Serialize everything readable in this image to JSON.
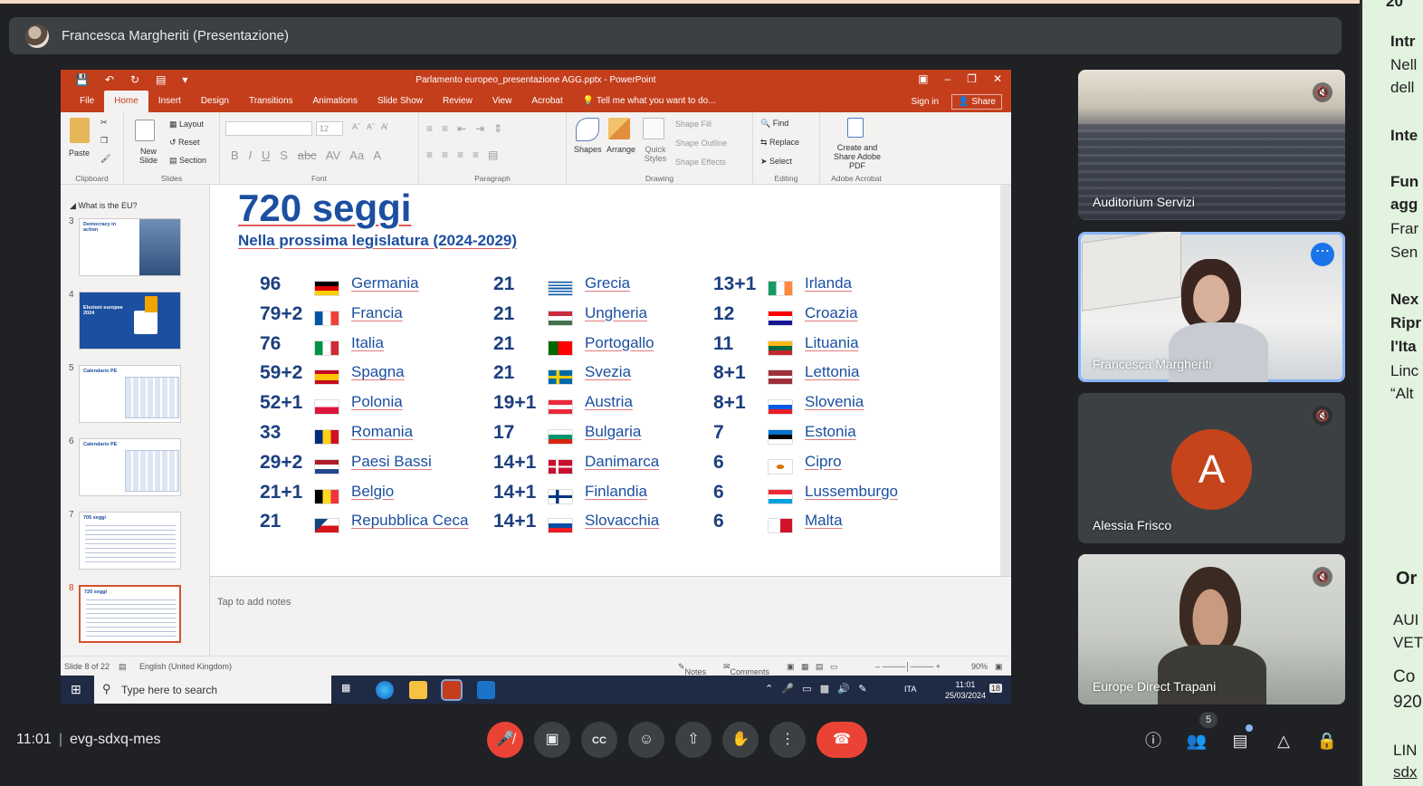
{
  "presenter_label": "Francesca Margheriti (Presentazione)",
  "powerpoint": {
    "doc_title": "Parlamento europeo_presentazione AGG.pptx - PowerPoint",
    "tabs": [
      "File",
      "Home",
      "Insert",
      "Design",
      "Transitions",
      "Animations",
      "Slide Show",
      "Review",
      "View",
      "Acrobat"
    ],
    "tell_me": "Tell me what you want to do...",
    "sign_in": "Sign in",
    "share": "Share",
    "ribbon": {
      "paste": "Paste",
      "clipboard": "Clipboard",
      "new_slide": "New Slide",
      "layout": "Layout",
      "reset": "Reset",
      "section": "Section",
      "slides": "Slides",
      "font_size": "12",
      "font": "Font",
      "paragraph": "Paragraph",
      "shapes": "Shapes",
      "arrange": "Arrange",
      "quick_styles": "Quick Styles",
      "shape_fill": "Shape Fill",
      "shape_outline": "Shape Outline",
      "shape_effects": "Shape Effects",
      "drawing": "Drawing",
      "find": "Find",
      "replace": "Replace",
      "select": "Select",
      "editing": "Editing",
      "create_share": "Create and Share Adobe PDF",
      "adobe_acrobat": "Adobe Acrobat"
    },
    "section_title": "What is the EU?",
    "thumbnails": [
      {
        "num": "3",
        "title": "Democracy in action"
      },
      {
        "num": "4",
        "title": "Elezioni europee 2024"
      },
      {
        "num": "5",
        "title": "Calendario PE"
      },
      {
        "num": "6",
        "title": "Calendario PE"
      },
      {
        "num": "7",
        "title": "705 seggi"
      },
      {
        "num": "8",
        "title": "720 seggi"
      }
    ],
    "slide": {
      "title": "720 seggi",
      "subtitle": "Nella prossima legislatura (2024-2029)",
      "columns": [
        [
          {
            "seats": "96",
            "country": "Germania",
            "flag": "de"
          },
          {
            "seats": "79+2",
            "country": "Francia",
            "flag": "fr"
          },
          {
            "seats": "76",
            "country": "Italia",
            "flag": "it"
          },
          {
            "seats": "59+2",
            "country": "Spagna",
            "flag": "es"
          },
          {
            "seats": "52+1",
            "country": "Polonia",
            "flag": "pl"
          },
          {
            "seats": "33",
            "country": "Romania",
            "flag": "ro"
          },
          {
            "seats": "29+2",
            "country": "Paesi Bassi",
            "flag": "nl"
          },
          {
            "seats": "21+1",
            "country": "Belgio",
            "flag": "be"
          },
          {
            "seats": "21",
            "country": "Repubblica Ceca",
            "flag": "cz"
          }
        ],
        [
          {
            "seats": "21",
            "country": "Grecia",
            "flag": "gr"
          },
          {
            "seats": "21",
            "country": "Ungheria",
            "flag": "hu"
          },
          {
            "seats": "21",
            "country": "Portogallo",
            "flag": "pt"
          },
          {
            "seats": "21",
            "country": "Svezia",
            "flag": "se"
          },
          {
            "seats": "19+1",
            "country": "Austria",
            "flag": "at"
          },
          {
            "seats": "17",
            "country": "Bulgaria",
            "flag": "bg"
          },
          {
            "seats": "14+1",
            "country": "Danimarca",
            "flag": "dk"
          },
          {
            "seats": "14+1",
            "country": "Finlandia",
            "flag": "fi"
          },
          {
            "seats": "14+1",
            "country": "Slovacchia",
            "flag": "sk"
          }
        ],
        [
          {
            "seats": "13+1",
            "country": "Irlanda",
            "flag": "ie"
          },
          {
            "seats": "12",
            "country": "Croazia",
            "flag": "hr"
          },
          {
            "seats": "11",
            "country": "Lituania",
            "flag": "lt"
          },
          {
            "seats": "8+1",
            "country": "Lettonia",
            "flag": "lv"
          },
          {
            "seats": "8+1",
            "country": "Slovenia",
            "flag": "si"
          },
          {
            "seats": "7",
            "country": "Estonia",
            "flag": "ee"
          },
          {
            "seats": "6",
            "country": "Cipro",
            "flag": "cy"
          },
          {
            "seats": "6",
            "country": "Lussemburgo",
            "flag": "lu"
          },
          {
            "seats": "6",
            "country": "Malta",
            "flag": "mt"
          }
        ]
      ]
    },
    "notes_placeholder": "Tap to add notes",
    "status": {
      "slide_counter": "Slide 8 of 22",
      "language": "English (United Kingdom)",
      "notes": "Notes",
      "comments": "Comments",
      "zoom": "90%"
    }
  },
  "taskbar": {
    "search_placeholder": "Type here to search",
    "language": "ITA",
    "time": "11:01",
    "date": "25/03/2024",
    "notifications": "18"
  },
  "participants": [
    {
      "name": "Auditorium Servizi",
      "muted": true
    },
    {
      "name": "Francesca Margheriti",
      "muted": false,
      "speaking": true
    },
    {
      "name": "Alessia Frisco",
      "muted": true,
      "initial": "A"
    },
    {
      "name": "Europe Direct Trapani",
      "muted": true
    }
  ],
  "side_panel_fragments": [
    "20",
    "Intr",
    "Nell",
    "dell",
    "Inte",
    "Fun",
    "agg",
    "Frar",
    "Sen",
    "Nex",
    "Ripr",
    "l'Ita",
    "Linc",
    "“Alt",
    "Or",
    "AUI",
    "VET",
    "Co",
    "920",
    "LIN",
    "sdx"
  ],
  "meeting": {
    "time": "11:01",
    "code": "evg-sdxq-mes",
    "participant_count": "5"
  },
  "colors": {
    "ppt_accent": "#c43e1c",
    "slide_blue": "#1c4fa0",
    "meet_dark": "#202124",
    "end_call": "#ea4335",
    "side_panel": "#e2f3e0"
  }
}
